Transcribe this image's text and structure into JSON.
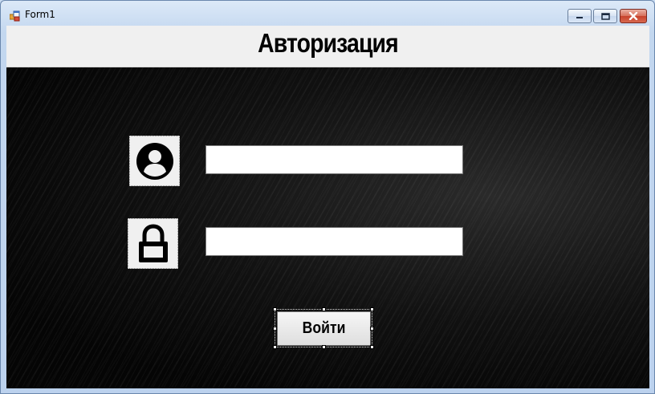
{
  "window": {
    "title": "Form1",
    "icon": "winforms-app-icon",
    "controls": [
      "minimize-icon",
      "maximize-icon",
      "close-icon"
    ]
  },
  "header": {
    "title": "Авторизация"
  },
  "form": {
    "login_icon": "user-circle-icon",
    "login_value": "",
    "password_icon": "lock-icon",
    "password_value": "",
    "submit_label": "Войти"
  },
  "colors": {
    "header_bg": "#f0f0f0",
    "background": "#000000",
    "field_bg": "#ffffff",
    "close_button": "#c7412b"
  }
}
